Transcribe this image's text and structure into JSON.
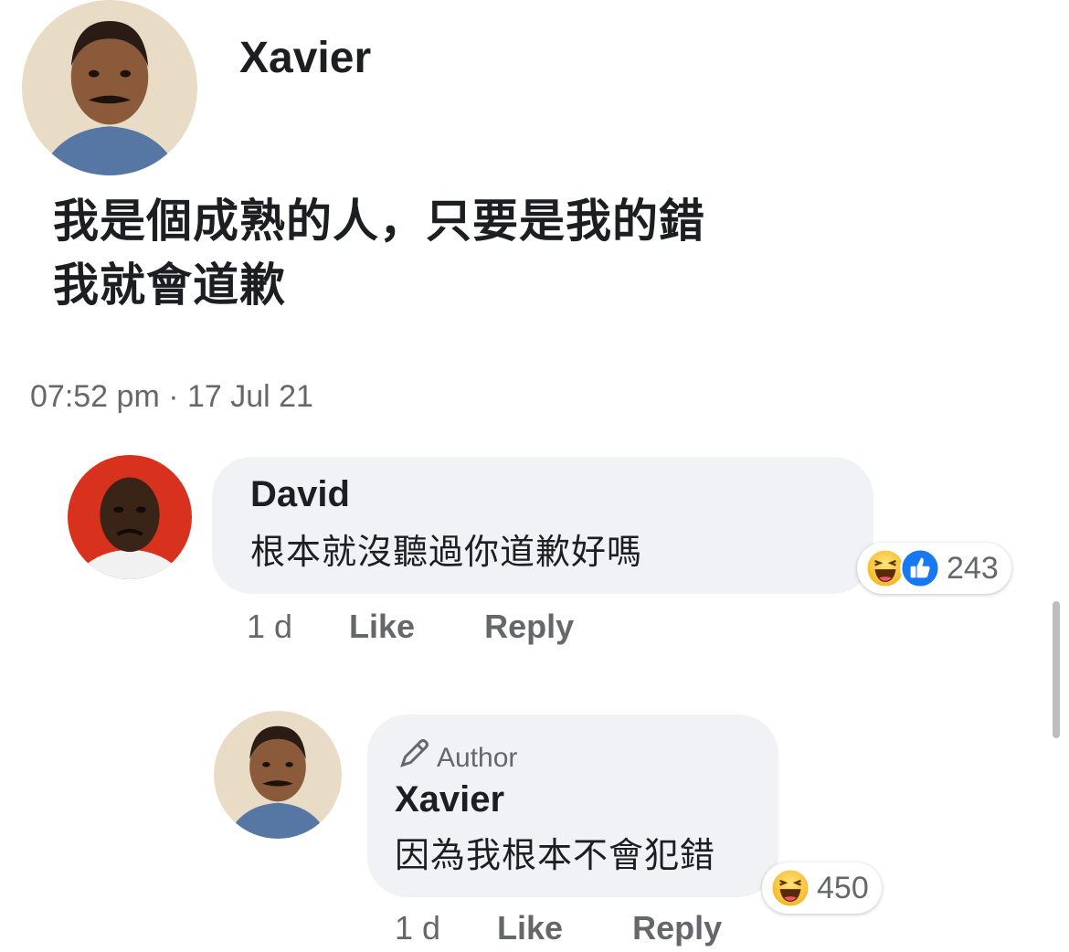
{
  "post": {
    "author": "Xavier",
    "text_line1": "我是個成熟的人，只要是我的錯",
    "text_line2": "我就會道歉",
    "timestamp": "07:52 pm · 17 Jul 21"
  },
  "comments": [
    {
      "author": "David",
      "text": "根本就沒聽過你道歉好嗎",
      "time": "1 d",
      "like_label": "Like",
      "reply_label": "Reply",
      "reaction_icons": [
        "haha-icon",
        "like-icon"
      ],
      "reaction_count": "243"
    },
    {
      "badge": "Author",
      "author": "Xavier",
      "text": "因為我根本不會犯錯",
      "time": "1 d",
      "like_label": "Like",
      "reply_label": "Reply",
      "reaction_icons": [
        "haha-icon"
      ],
      "reaction_count": "450"
    }
  ],
  "colors": {
    "bubble": "#f0f2f5",
    "muted_text": "#65676b",
    "like_blue": "#1877f2",
    "haha_yellow": "#f7c02a"
  }
}
